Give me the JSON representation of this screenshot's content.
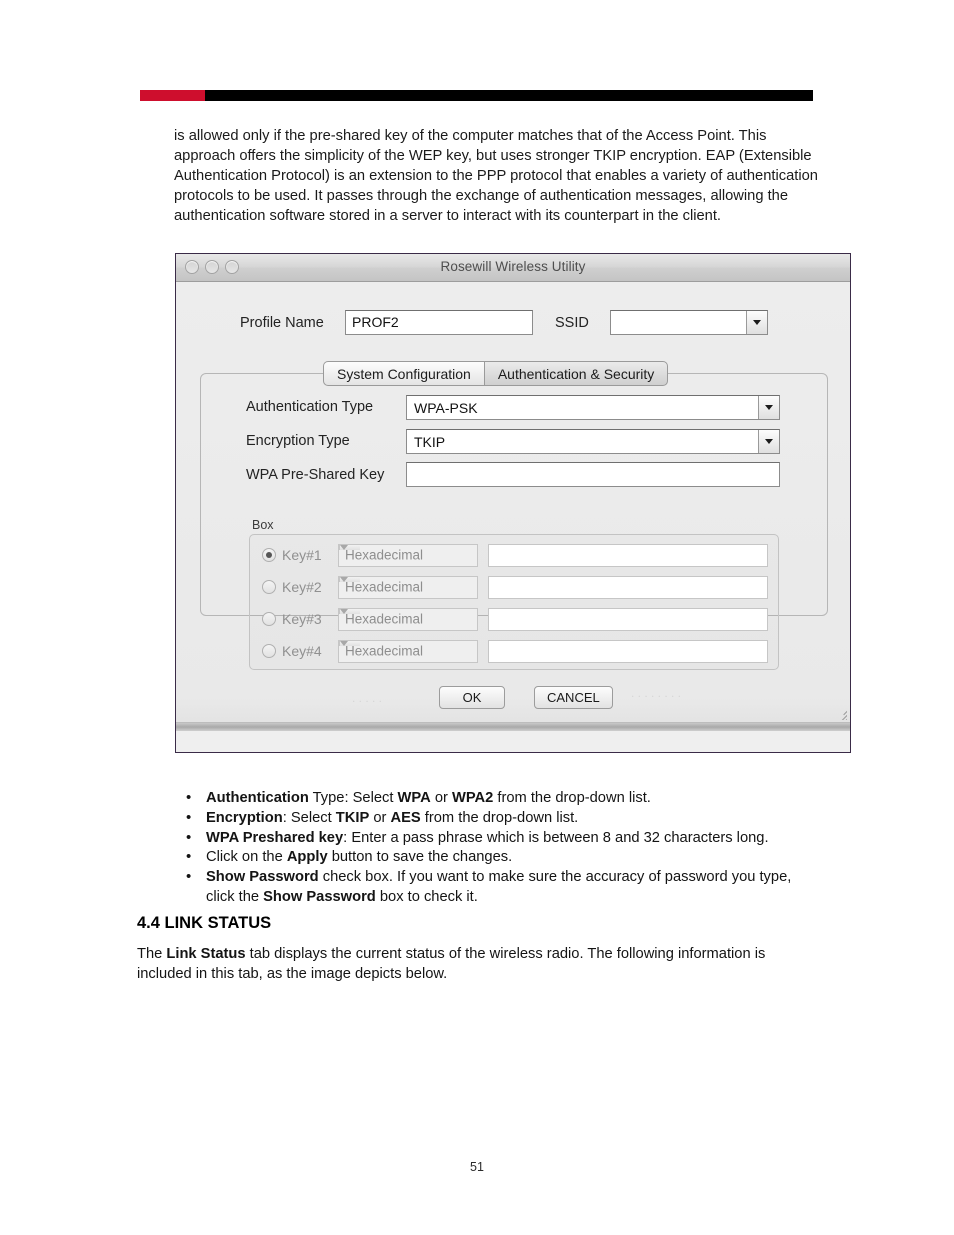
{
  "document": {
    "page_number": "51",
    "header_rule": {
      "accent_color": "#ce0e2d",
      "bar_color": "#000000"
    },
    "intro_paragraph": "is allowed only if the pre-shared key of the computer matches that of the Access Point. This approach offers the simplicity of the WEP key, but uses stronger TKIP encryption. EAP (Extensible Authentication Protocol) is an extension to the PPP protocol that enables a variety of authentication protocols to be used. It passes through the exchange of authentication messages, allowing the authentication software stored in a server to interact with its counterpart in the client.",
    "section": {
      "heading": "4.4 LINK STATUS",
      "paragraph_before_bold": "The ",
      "paragraph_bold": "Link Status",
      "paragraph_after_bold": " tab displays the current status of the wireless radio.  The following information is included in this tab, as the image depicts below."
    }
  },
  "bullets": [
    {
      "bold1": "Authentication",
      "text1": " Type: Select ",
      "bold2": "WPA",
      "text2": " or ",
      "bold3": "WPA2",
      "text3": " from the drop-down list."
    },
    {
      "bold1": "Encryption",
      "text1": ": Select ",
      "bold2": "TKIP",
      "text2": " or ",
      "bold3": "AES",
      "text3": " from the drop-down list."
    },
    {
      "bold1": "WPA Preshared key",
      "text1": ": Enter a pass phrase which is between 8 and 32 characters long.",
      "bold2": "",
      "text2": "",
      "bold3": "",
      "text3": ""
    },
    {
      "bold1": "",
      "text1": "Click on the ",
      "bold2": "Apply",
      "text2": " button to save the changes.",
      "bold3": "",
      "text3": ""
    },
    {
      "bold1": "Show Password",
      "text1": " check box. If you want to make sure the accuracy of password you type, click the ",
      "bold2": "Show Password",
      "text2": " box to check it.",
      "bold3": "",
      "text3": ""
    }
  ],
  "window": {
    "title": "Rosewill Wireless Utility",
    "traffic_lights": [
      "close-button",
      "minimize-button",
      "zoom-button"
    ],
    "profile": {
      "label": "Profile Name",
      "value": "PROF2",
      "placeholder": ""
    },
    "ssid": {
      "label": "SSID",
      "value": "",
      "placeholder": ""
    },
    "tabs": [
      {
        "label": "System Configuration",
        "selected": false
      },
      {
        "label": "Authentication & Security",
        "selected": true
      }
    ],
    "fields": {
      "auth_type": {
        "label": "Authentication Type",
        "value": "WPA-PSK"
      },
      "encryption_type": {
        "label": "Encryption Type",
        "value": "TKIP"
      },
      "psk": {
        "label": "WPA Pre-Shared Key",
        "value": ""
      }
    },
    "key_group": {
      "caption": "Box",
      "rows": [
        {
          "label": "Key#1",
          "format": "Hexadecimal",
          "value": "",
          "selected": true
        },
        {
          "label": "Key#2",
          "format": "Hexadecimal",
          "value": "",
          "selected": false
        },
        {
          "label": "Key#3",
          "format": "Hexadecimal",
          "value": "",
          "selected": false
        },
        {
          "label": "Key#4",
          "format": "Hexadecimal",
          "value": "",
          "selected": false
        }
      ]
    },
    "buttons": {
      "ok": "OK",
      "cancel": "CANCEL"
    }
  }
}
